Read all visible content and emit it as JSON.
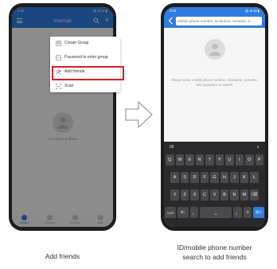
{
  "left_phone": {
    "status_time": "2:03",
    "status_icons": "⁂ 5ᵢl 5ᵢl ▮",
    "header_title": "Interrupt",
    "menu": [
      {
        "label": "Create Group",
        "icon": "create-group-icon"
      },
      {
        "label": "Password to enter group",
        "icon": "password-icon"
      },
      {
        "label": "Add friends",
        "icon": "add-friends-icon"
      },
      {
        "label": "Scan",
        "icon": "scan-icon"
      }
    ],
    "empty_hint": "Go chat to a friend",
    "nav": [
      {
        "label": "Session"
      },
      {
        "label": "Contacts"
      },
      {
        "label": "Discover"
      },
      {
        "label": "Mine"
      }
    ],
    "accent_color": "#2f7de1",
    "highlight_color": "#d81e2c"
  },
  "right_phone": {
    "status_time": "2:03",
    "status_icons": "⁂ 5ᵢl 5ᵢl ▮",
    "search_placeholder": "Mobile phone number, nickname, remarks, si",
    "empty_hint": "Please enter mobile phone number, nickname, remarks, and signature to search",
    "keyboard": {
      "toolbar_left": "88",
      "toolbar_right": "∨",
      "row1": [
        "Q",
        "W",
        "E",
        "R",
        "T",
        "Y",
        "U",
        "I",
        "O",
        "P"
      ],
      "row2": [
        "A",
        "S",
        "D",
        "F",
        "G",
        "H",
        "J",
        "K",
        "L"
      ],
      "row3": [
        "⇧",
        "Z",
        "X",
        "C",
        "V",
        "B",
        "N",
        "M",
        "⌫"
      ],
      "row4": [
        "?123",
        "中/,",
        "，",
        "⎵",
        "。",
        "☺",
        "换行"
      ]
    }
  },
  "captions": {
    "left": "Add friends",
    "right_line1": "ID/mobile phone number",
    "right_line2": "search to add friends"
  }
}
